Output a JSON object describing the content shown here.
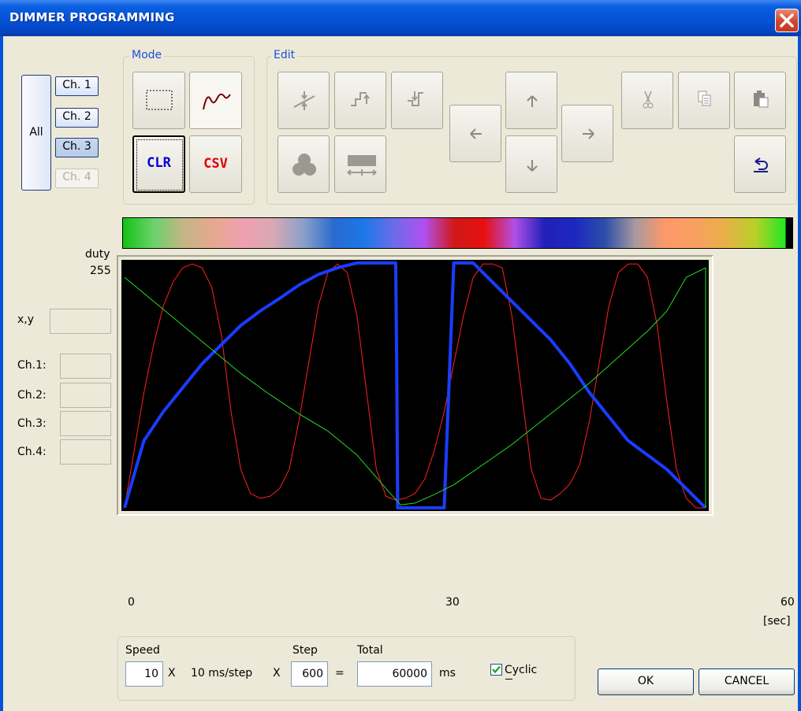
{
  "window": {
    "title": "DIMMER PROGRAMMING",
    "close_icon": "close-icon"
  },
  "channels": {
    "all_label": "All",
    "items": [
      {
        "label": "Ch. 1",
        "state": "normal"
      },
      {
        "label": "Ch. 2",
        "state": "normal"
      },
      {
        "label": "Ch. 3",
        "state": "pressed"
      },
      {
        "label": "Ch. 4",
        "state": "disabled"
      }
    ]
  },
  "mode": {
    "label": "Mode",
    "select_icon": "rectangle-select-icon",
    "draw_icon": "freehand-curve-icon",
    "clr_label": "CLR",
    "csv_label": "CSV"
  },
  "edit": {
    "label": "Edit",
    "icons": [
      "scale-vertical-icon",
      "step-up-icon",
      "step-down-icon",
      "smooth-icon",
      "stretch-horizontal-icon",
      "arrow-left-icon",
      "arrow-up-icon",
      "arrow-down-icon",
      "arrow-right-icon",
      "cut-icon",
      "copy-icon",
      "paste-icon",
      "undo-icon"
    ]
  },
  "readout": {
    "duty_label": "duty",
    "duty_max": "255",
    "xy_label": "x,y",
    "ch_labels": [
      "Ch.1:",
      "Ch.2:",
      "Ch.3:",
      "Ch.4:"
    ]
  },
  "chart_data": {
    "type": "line",
    "background": "#000000",
    "xlim": [
      0,
      60
    ],
    "ylim": [
      0,
      255
    ],
    "x_ticks": [
      "0",
      "30",
      "60"
    ],
    "x_unit": "[sec]",
    "series": [
      {
        "color": "#ff2020",
        "width": 1,
        "x": [
          0,
          1,
          2,
          3,
          4,
          5,
          6,
          7,
          8,
          9,
          10,
          11,
          12,
          13,
          14,
          15,
          16,
          17,
          18,
          19,
          20,
          21,
          22,
          23,
          24,
          25,
          26,
          27,
          28,
          29,
          30,
          31,
          32,
          33,
          34,
          35,
          36,
          37,
          38,
          39,
          40,
          41,
          42,
          43,
          44,
          45,
          46,
          47,
          48,
          49,
          50,
          51,
          52,
          53,
          54,
          55,
          56,
          57,
          58,
          59,
          60
        ],
        "y": [
          0,
          60,
          120,
          170,
          210,
          235,
          250,
          254,
          250,
          230,
          180,
          100,
          40,
          15,
          10,
          12,
          20,
          40,
          90,
          150,
          210,
          245,
          254,
          245,
          200,
          120,
          40,
          12,
          8,
          10,
          15,
          30,
          60,
          100,
          150,
          200,
          240,
          254,
          254,
          250,
          200,
          120,
          40,
          10,
          8,
          15,
          25,
          45,
          90,
          150,
          210,
          245,
          254,
          254,
          240,
          190,
          110,
          40,
          10,
          0,
          0
        ]
      },
      {
        "color": "#1a3cff",
        "width": 4,
        "x": [
          0,
          2,
          4,
          6,
          8,
          10,
          12,
          14,
          16,
          18,
          20,
          22,
          24,
          26,
          28,
          28.1,
          28.2,
          29,
          30,
          31,
          32,
          33,
          34,
          36,
          38,
          40,
          42,
          44,
          46,
          48,
          50,
          52,
          54,
          56,
          58,
          60
        ],
        "y": [
          0,
          70,
          100,
          125,
          150,
          170,
          190,
          205,
          218,
          232,
          243,
          250,
          255,
          255,
          255,
          150,
          0,
          0,
          0,
          0,
          0,
          0,
          255,
          255,
          235,
          215,
          195,
          175,
          150,
          120,
          95,
          70,
          55,
          40,
          20,
          0
        ]
      },
      {
        "color": "#22dd22",
        "width": 1,
        "x": [
          0,
          3,
          6,
          9,
          12,
          15,
          18,
          21,
          24,
          27,
          28.5,
          30,
          32,
          34,
          36,
          38,
          40,
          42,
          44,
          46,
          48,
          50,
          52,
          54,
          56,
          58,
          60,
          60
        ],
        "y": [
          240,
          215,
          190,
          165,
          140,
          118,
          98,
          80,
          55,
          20,
          3,
          5,
          14,
          24,
          38,
          52,
          66,
          82,
          98,
          114,
          130,
          148,
          166,
          184,
          205,
          240,
          250,
          0
        ]
      }
    ]
  },
  "colorbar": {
    "stops": [
      "#13c213",
      "#6ad26a",
      "#c4b585",
      "#e6a890",
      "#f0a0b0",
      "#d8a8b4",
      "#8aa0c8",
      "#2a6ad0",
      "#1a78e8",
      "#6c6ce8",
      "#b050f0",
      "#d01818",
      "#e81010",
      "#b050e8",
      "#2020b8",
      "#1c28c0",
      "#2c4ea8",
      "#a898a0",
      "#ff9868",
      "#f8a060",
      "#e8b048",
      "#b8d028",
      "#20e820",
      "#000000"
    ]
  },
  "params": {
    "speed_label": "Speed",
    "speed_value": "10",
    "mult1": "X",
    "ms_per_step": "10 ms/step",
    "mult2": "X",
    "step_label": "Step",
    "step_value": "600",
    "equals": "=",
    "total_label": "Total",
    "total_value": "60000",
    "ms_label": "ms",
    "cyclic_label": "Cyclic",
    "cyclic_checked": true
  },
  "dialog": {
    "ok_label": "OK",
    "cancel_label": "CANCEL"
  }
}
